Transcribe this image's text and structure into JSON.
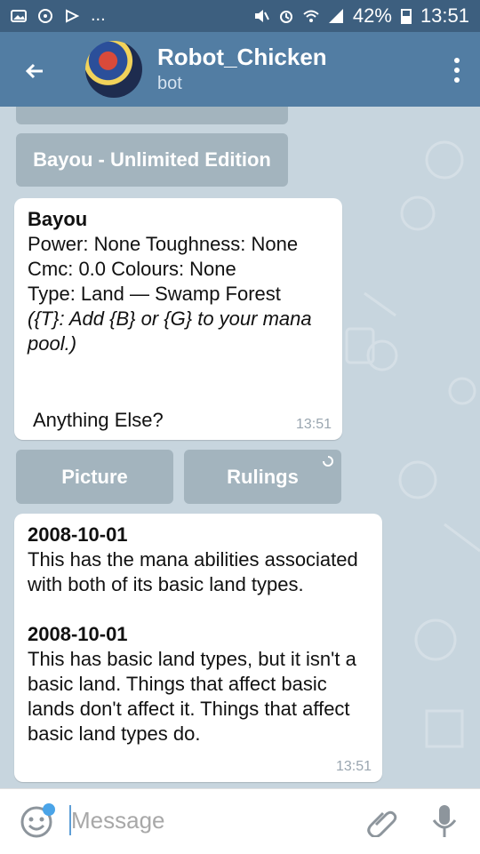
{
  "status_bar": {
    "dots": "...",
    "battery": "42%",
    "time": "13:51"
  },
  "header": {
    "title": "Robot_Chicken",
    "subtitle": "bot"
  },
  "keyboard": {
    "top_button": "Bayou - Unlimited Edition",
    "picture": "Picture",
    "rulings": "Rulings"
  },
  "message1": {
    "title": "Bayou",
    "line1": "Power: None Toughness: None",
    "line2": "Cmc: 0.0 Colours: None",
    "line3": "Type: Land — Swamp Forest",
    "italic": "({T}: Add {B} or {G} to your mana pool.)",
    "closing": "Anything Else?",
    "time": "13:51"
  },
  "message2": {
    "date1": "2008-10-01",
    "text1": "This has the mana abilities associated with both of its basic land types.",
    "date2": "2008-10-01",
    "text2": "This has basic land types, but it isn't a basic land. Things that affect basic lands don't affect it. Things that affect basic land types do.",
    "time": "13:51"
  },
  "composer": {
    "placeholder": "Message"
  }
}
